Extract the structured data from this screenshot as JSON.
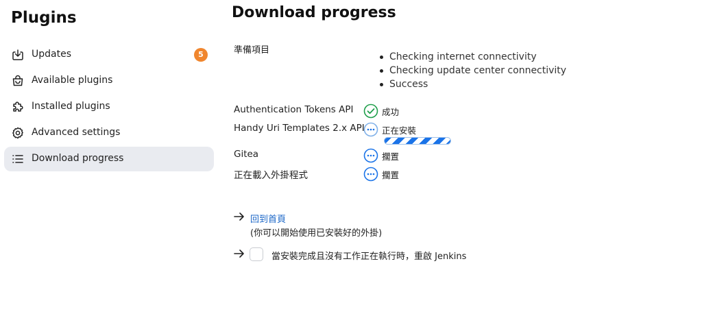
{
  "sidebar": {
    "title": "Plugins",
    "items": [
      {
        "label": "Updates",
        "icon": "download-tray-icon",
        "badge": "5"
      },
      {
        "label": "Available plugins",
        "icon": "shopping-bag-icon"
      },
      {
        "label": "Installed plugins",
        "icon": "puzzle-icon"
      },
      {
        "label": "Advanced settings",
        "icon": "gear-icon"
      },
      {
        "label": "Download progress",
        "icon": "list-icon",
        "active": true
      }
    ]
  },
  "main": {
    "title": "Download progress",
    "preparation": {
      "label": "準備項目",
      "checks": [
        "Checking internet connectivity",
        "Checking update center connectivity",
        "Success"
      ]
    },
    "plugins": [
      {
        "name": "Authentication Tokens API",
        "status": "成功",
        "state": "success"
      },
      {
        "name": "Handy Uri Templates 2.x API",
        "status": "正在安裝",
        "state": "installing",
        "progress": 1.0
      },
      {
        "name": "Gitea",
        "status": "擱置",
        "state": "pending"
      },
      {
        "name": "正在載入外掛程式",
        "status": "擱置",
        "state": "pending"
      }
    ],
    "home_link": "回到首頁",
    "home_sub": "(你可以開始使用已安裝好的外掛)",
    "restart_label": "當安裝完成且沒有工作正在執行時，重啟 Jenkins",
    "restart_checked": false
  },
  "colors": {
    "accent": "#1a73e8",
    "success": "#1e9e4a",
    "badge": "#f0862e",
    "active_bg": "#e9ebf0",
    "link": "#1a66c7"
  }
}
